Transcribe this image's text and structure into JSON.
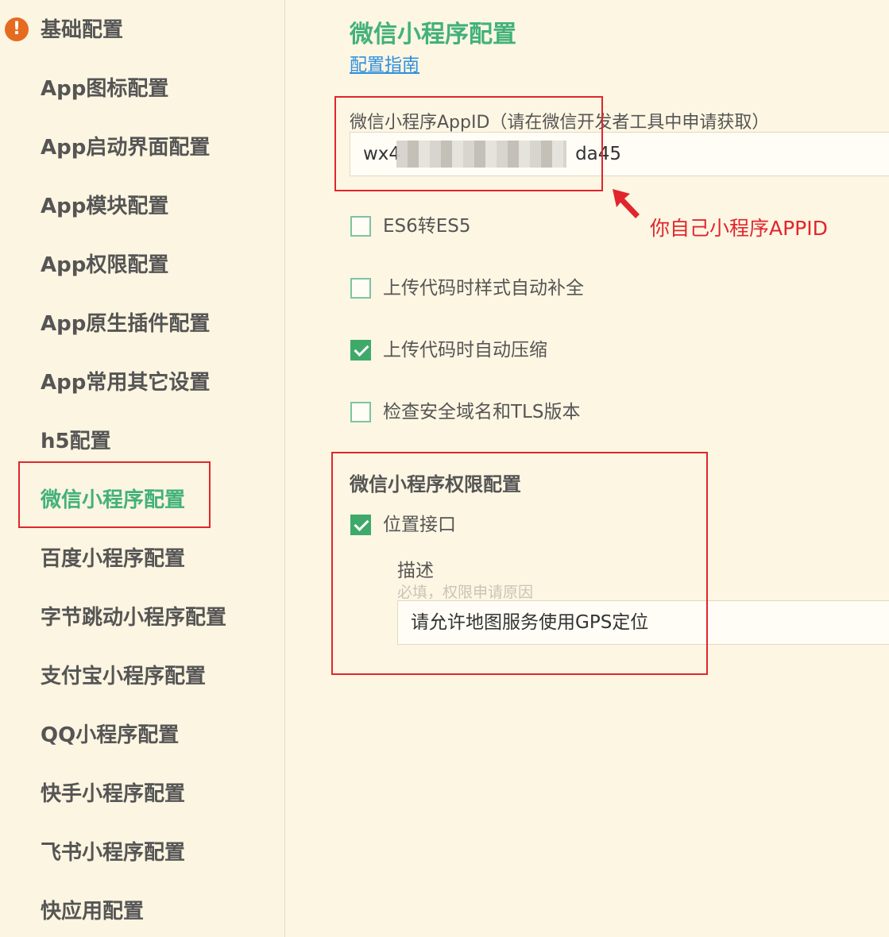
{
  "sidebar": {
    "items": [
      {
        "label": "基础配置",
        "warning": true
      },
      {
        "label": "App图标配置"
      },
      {
        "label": "App启动界面配置"
      },
      {
        "label": "App模块配置"
      },
      {
        "label": "App权限配置"
      },
      {
        "label": "App原生插件配置"
      },
      {
        "label": "App常用其它设置"
      },
      {
        "label": "h5配置"
      },
      {
        "label": "微信小程序配置",
        "active": true
      },
      {
        "label": "百度小程序配置"
      },
      {
        "label": "字节跳动小程序配置"
      },
      {
        "label": "支付宝小程序配置"
      },
      {
        "label": "QQ小程序配置"
      },
      {
        "label": "快手小程序配置"
      },
      {
        "label": "飞书小程序配置"
      },
      {
        "label": "快应用配置"
      }
    ],
    "warning_icon": "!"
  },
  "main": {
    "title": "微信小程序配置",
    "guide_link": "配置指南",
    "appid": {
      "label": "微信小程序AppID（请在微信开发者工具中申请获取）",
      "value_prefix": "wx4",
      "value_suffix": "da45"
    },
    "checkboxes": [
      {
        "label": "ES6转ES5",
        "checked": false
      },
      {
        "label": "上传代码时样式自动补全",
        "checked": false
      },
      {
        "label": "上传代码时自动压缩",
        "checked": true
      },
      {
        "label": "检查安全域名和TLS版本",
        "checked": false
      }
    ],
    "permissions": {
      "title": "微信小程序权限配置",
      "location": {
        "label": "位置接口",
        "checked": true
      },
      "desc_label": "描述",
      "desc_hint": "必填，权限申请原因",
      "desc_value": "请允许地图服务使用GPS定位"
    }
  },
  "annotation": {
    "text": "你自己小程序APPID",
    "color": "#e0262c"
  },
  "colors": {
    "accent": "#42b17a",
    "background": "#fdf6e3",
    "link": "#2f8fdc",
    "warning": "#e56b21"
  }
}
